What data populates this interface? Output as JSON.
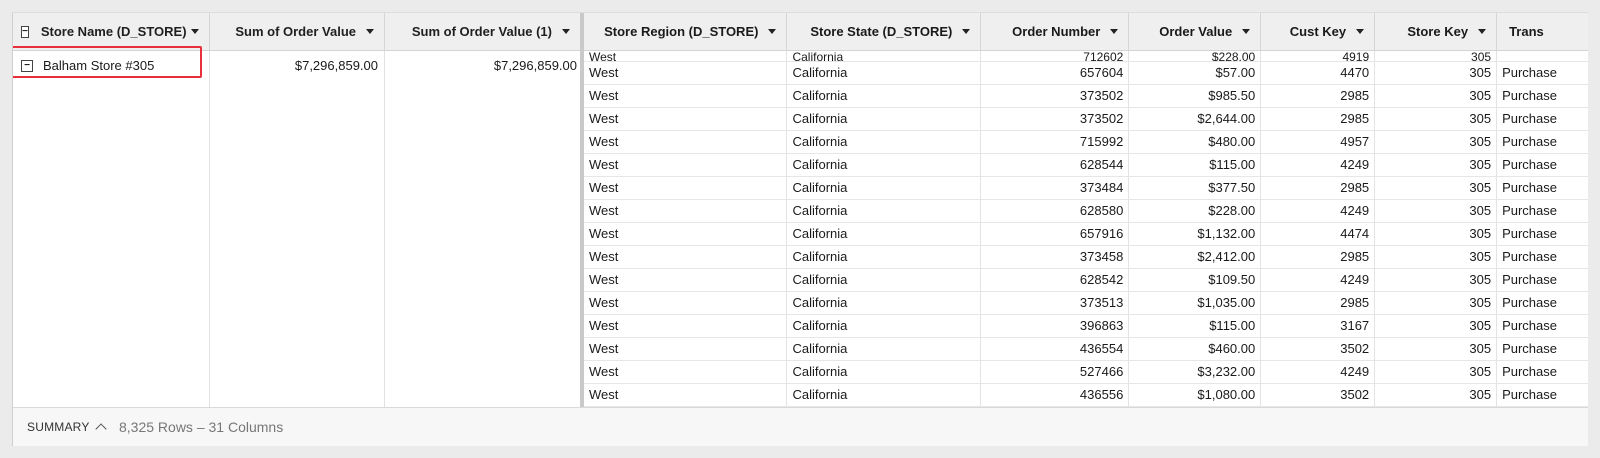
{
  "pivot": {
    "headers": {
      "store_name": "Store Name (D_STORE)",
      "sum_order_value": "Sum of Order Value",
      "sum_order_value_1": "Sum of Order Value (1)"
    },
    "row": {
      "store_name": "Balham Store #305",
      "sum_order_value": "$7,296,859.00",
      "sum_order_value_1": "$7,296,859.00"
    }
  },
  "detail": {
    "columns": [
      "Store Region (D_STORE)",
      "Store State (D_STORE)",
      "Order Number",
      "Order Value",
      "Cust Key",
      "Store Key",
      "Trans"
    ],
    "partial_first_row": [
      "West",
      "California",
      "712602",
      "$228.00",
      "4919",
      "305",
      ""
    ],
    "rows": [
      [
        "West",
        "California",
        "657604",
        "$57.00",
        "4470",
        "305",
        "Purchase"
      ],
      [
        "West",
        "California",
        "373502",
        "$985.50",
        "2985",
        "305",
        "Purchase"
      ],
      [
        "West",
        "California",
        "373502",
        "$2,644.00",
        "2985",
        "305",
        "Purchase"
      ],
      [
        "West",
        "California",
        "715992",
        "$480.00",
        "4957",
        "305",
        "Purchase"
      ],
      [
        "West",
        "California",
        "628544",
        "$115.00",
        "4249",
        "305",
        "Purchase"
      ],
      [
        "West",
        "California",
        "373484",
        "$377.50",
        "2985",
        "305",
        "Purchase"
      ],
      [
        "West",
        "California",
        "628580",
        "$228.00",
        "4249",
        "305",
        "Purchase"
      ],
      [
        "West",
        "California",
        "657916",
        "$1,132.00",
        "4474",
        "305",
        "Purchase"
      ],
      [
        "West",
        "California",
        "373458",
        "$2,412.00",
        "2985",
        "305",
        "Purchase"
      ],
      [
        "West",
        "California",
        "628542",
        "$109.50",
        "4249",
        "305",
        "Purchase"
      ],
      [
        "West",
        "California",
        "373513",
        "$1,035.00",
        "2985",
        "305",
        "Purchase"
      ],
      [
        "West",
        "California",
        "396863",
        "$115.00",
        "3167",
        "305",
        "Purchase"
      ],
      [
        "West",
        "California",
        "436554",
        "$460.00",
        "3502",
        "305",
        "Purchase"
      ],
      [
        "West",
        "California",
        "527466",
        "$3,232.00",
        "4249",
        "305",
        "Purchase"
      ],
      [
        "West",
        "California",
        "436556",
        "$1,080.00",
        "3502",
        "305",
        "Purchase"
      ]
    ]
  },
  "footer": {
    "summary_label": "SUMMARY",
    "row_count": "8,325 Rows – 31 Columns"
  },
  "colors": {
    "highlight": "#e8303a",
    "header_bg": "#efefef"
  }
}
